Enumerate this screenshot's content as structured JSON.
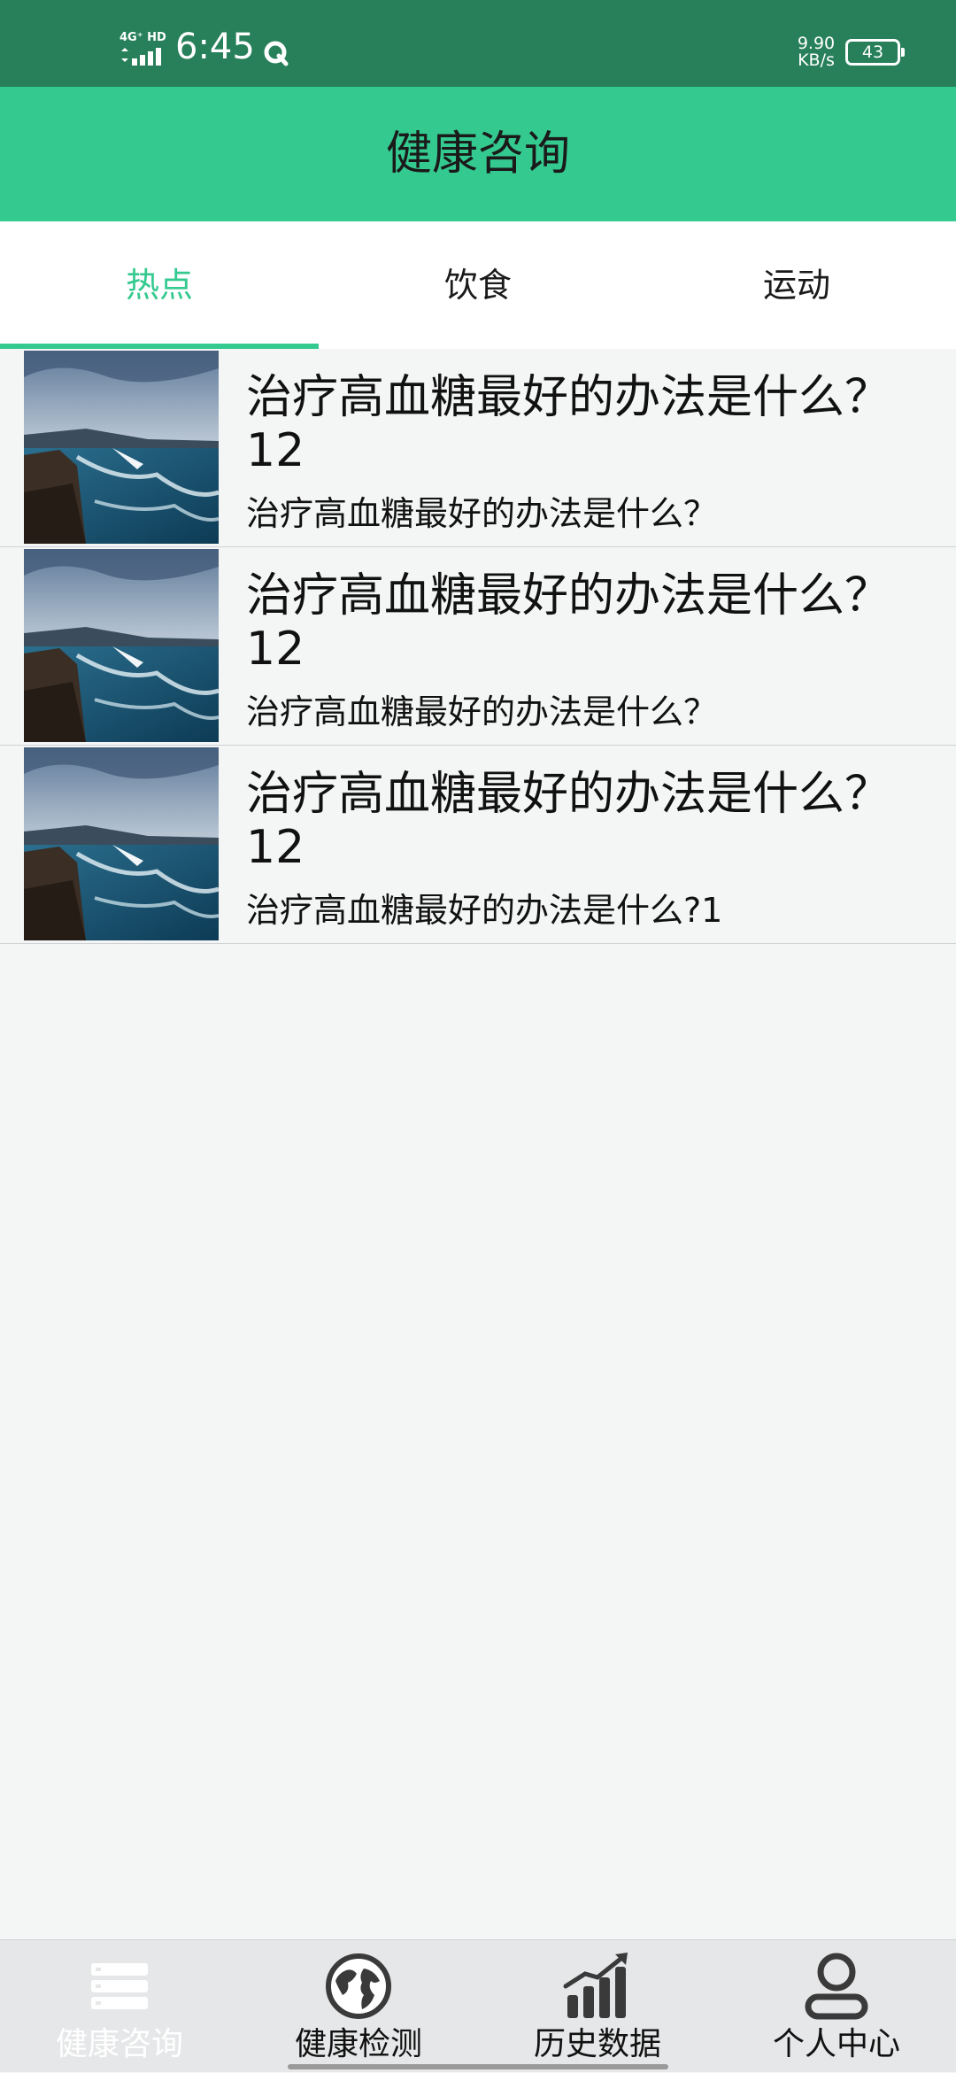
{
  "status_bar": {
    "network": "4G⁺ HD",
    "time": "6:45",
    "speed_value": "9.90",
    "speed_unit": "KB/s",
    "battery": "43"
  },
  "header": {
    "title": "健康咨询"
  },
  "tabs": [
    {
      "label": "热点",
      "active": true
    },
    {
      "label": "饮食",
      "active": false
    },
    {
      "label": "运动",
      "active": false
    }
  ],
  "articles": [
    {
      "title": "治疗高血糖最好的办法是什么？",
      "number": "12",
      "subtitle": "治疗高血糖最好的办法是什么？",
      "image": "coastal-seascape-thumbnail"
    },
    {
      "title": "治疗高血糖最好的办法是什么？",
      "number": "12",
      "subtitle": "治疗高血糖最好的办法是什么？",
      "image": "coastal-seascape-thumbnail"
    },
    {
      "title": "治疗高血糖最好的办法是什么？",
      "number": "12",
      "subtitle": "治疗高血糖最好的办法是什么?1",
      "image": "coastal-seascape-thumbnail"
    }
  ],
  "bottom_nav": [
    {
      "label": "健康咨询",
      "icon": "list-icon",
      "active": true
    },
    {
      "label": "健康检测",
      "icon": "globe-icon",
      "active": false
    },
    {
      "label": "历史数据",
      "icon": "bar-chart-icon",
      "active": false
    },
    {
      "label": "个人中心",
      "icon": "user-icon",
      "active": false
    }
  ],
  "colors": {
    "status_bar": "#27805a",
    "accent": "#34c98f",
    "background": "#f4f5f5",
    "nav_background": "#e6e7e8"
  }
}
